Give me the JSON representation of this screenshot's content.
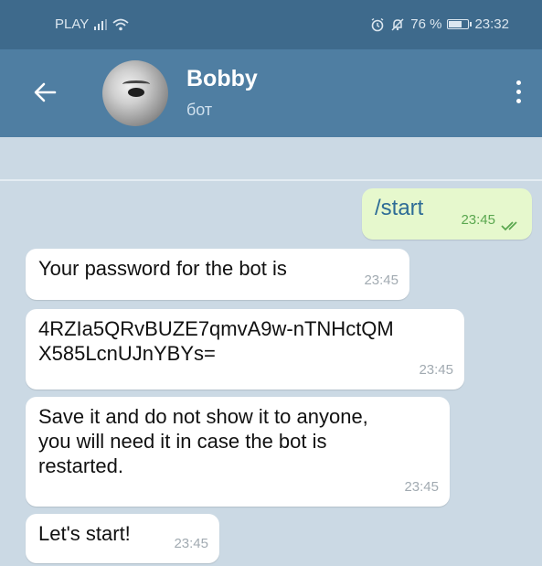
{
  "status_bar": {
    "carrier": "PLAY",
    "battery": "76 %",
    "battery_level": 0.76,
    "time": "23:32",
    "icons": [
      "signal-icon",
      "wifi-icon",
      "alarm-icon",
      "mute-icon",
      "battery-icon"
    ]
  },
  "header": {
    "title": "Bobby",
    "subtitle": "бот",
    "icons": [
      "back-arrow-icon",
      "avatar",
      "more-vert-icon"
    ]
  },
  "messages": [
    {
      "direction": "out",
      "text": "/start",
      "time": "23:45",
      "status": "read-double-check"
    },
    {
      "direction": "in",
      "text": "Your password for the bot is",
      "time": "23:45"
    },
    {
      "direction": "in",
      "text": "4RZIa5QRvBUZE7qmvA9w-nTNHctQM\nX585LcnUJnYBYs=",
      "time": "23:45"
    },
    {
      "direction": "in",
      "text": "Save it and do not show it to anyone,\nyou will need it in case the bot is\nrestarted.",
      "time": "23:45"
    },
    {
      "direction": "in",
      "text": "Let's start!",
      "time": "23:45"
    }
  ],
  "colors": {
    "status_bar": "#3e6a8c",
    "app_bar": "#4f7ea2",
    "chat_bg": "#cbd9e4",
    "outgoing_bubble": "#e6f8cd",
    "incoming_bubble": "#ffffff",
    "read_check": "#5aa74f"
  }
}
